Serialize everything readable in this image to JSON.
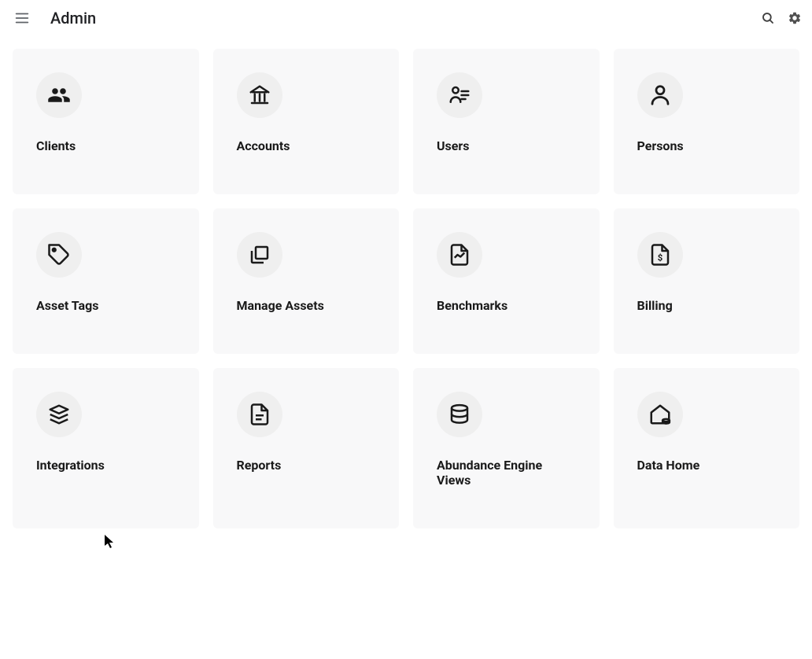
{
  "header": {
    "title": "Admin"
  },
  "cards": [
    {
      "label": "Clients",
      "icon": "clients"
    },
    {
      "label": "Accounts",
      "icon": "accounts"
    },
    {
      "label": "Users",
      "icon": "users"
    },
    {
      "label": "Persons",
      "icon": "persons"
    },
    {
      "label": "Asset Tags",
      "icon": "asset-tags"
    },
    {
      "label": "Manage Assets",
      "icon": "manage-assets"
    },
    {
      "label": "Benchmarks",
      "icon": "benchmarks"
    },
    {
      "label": "Billing",
      "icon": "billing"
    },
    {
      "label": "Integrations",
      "icon": "integrations"
    },
    {
      "label": "Reports",
      "icon": "reports"
    },
    {
      "label": "Abundance Engine Views",
      "icon": "abundance"
    },
    {
      "label": "Data Home",
      "icon": "data-home"
    }
  ]
}
